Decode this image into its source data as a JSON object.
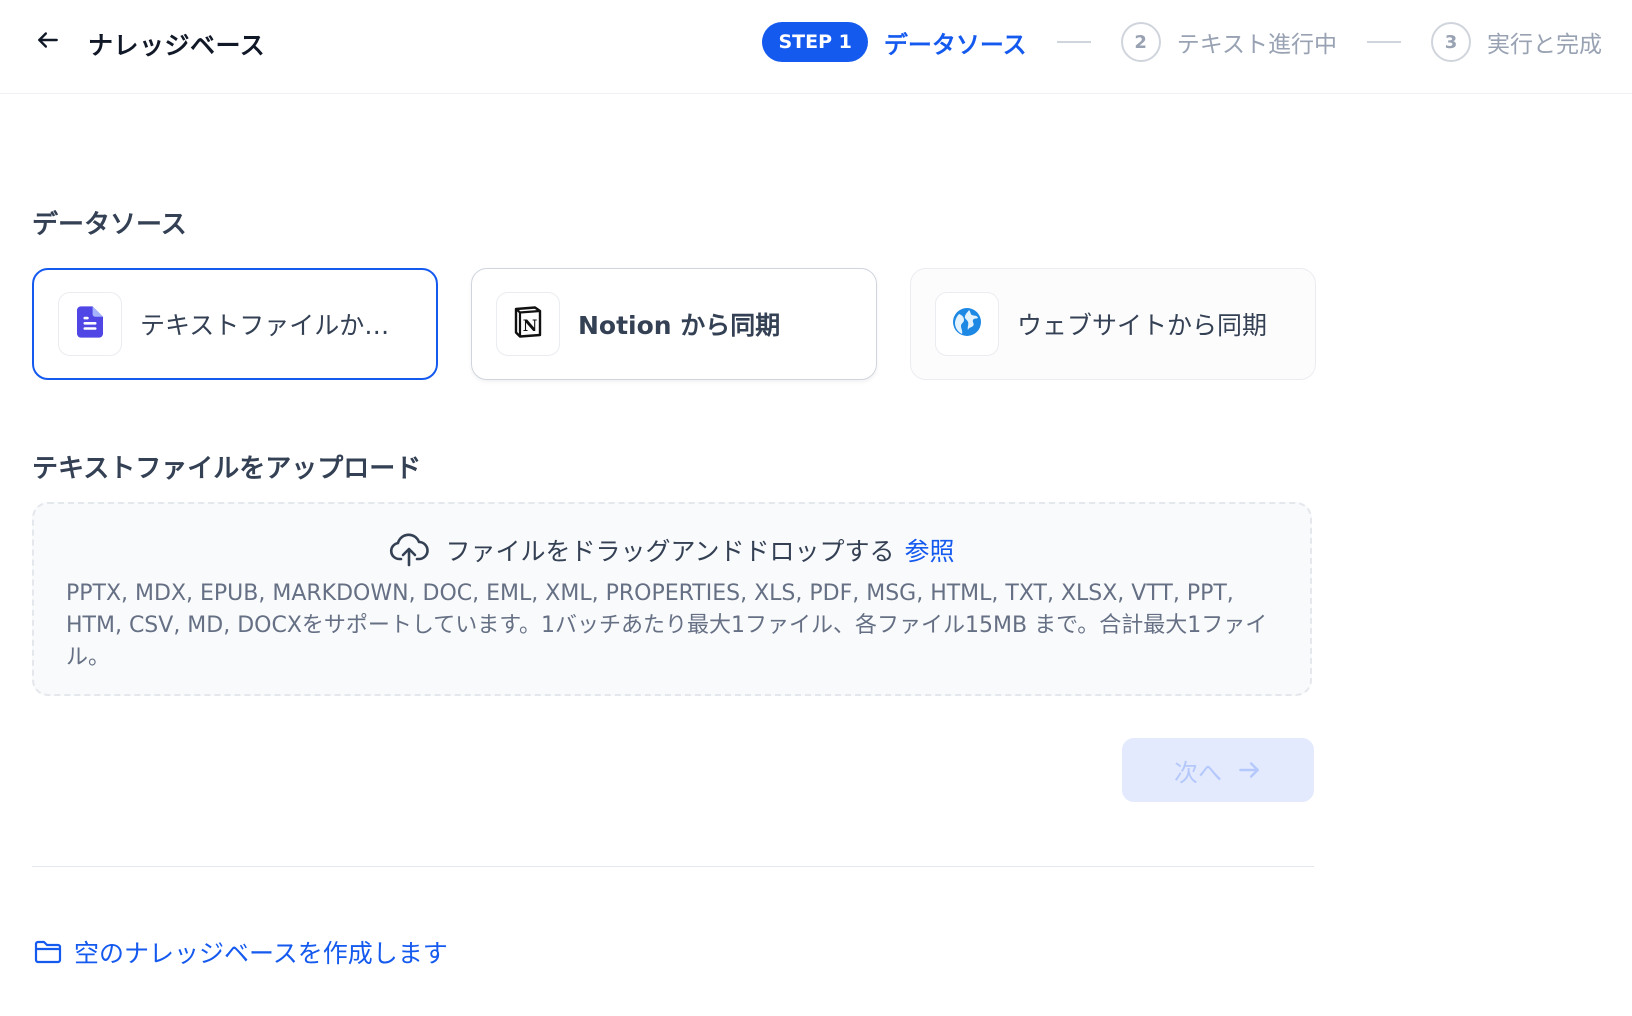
{
  "header": {
    "title": "ナレッジベース",
    "back_icon": "arrow-left-icon"
  },
  "stepper": {
    "active": {
      "badge": "STEP 1",
      "label": "データソース"
    },
    "steps": [
      {
        "number": "2",
        "label": "テキスト進行中"
      },
      {
        "number": "3",
        "label": "実行と完成"
      }
    ]
  },
  "data_source": {
    "title": "データソース",
    "options": [
      {
        "label": "テキストファイルからインポート",
        "icon": "file-text-icon",
        "selected": true
      },
      {
        "label": "Notion から同期",
        "icon": "notion-icon",
        "selected": false
      },
      {
        "label": "ウェブサイトから同期",
        "icon": "globe-icon",
        "selected": false
      }
    ]
  },
  "upload": {
    "title": "テキストファイルをアップロード",
    "drop_text": "ファイルをドラッグアンドドロップする",
    "browse_label": "参照",
    "supported_text": "PPTX, MDX, EPUB, MARKDOWN, DOC, EML, XML, PROPERTIES, XLS, PDF, MSG, HTML, TXT, XLSX, VTT, PPT, HTM, CSV, MD, DOCXをサポートしています。1バッチあたり最大1ファイル、各ファイル15MB まで。合計最大1ファイル。"
  },
  "next_button": {
    "label": "次へ",
    "disabled": true
  },
  "create_empty": {
    "label": "空のナレッジベースを作成します",
    "icon": "folder-icon"
  },
  "colors": {
    "primary": "#155aef",
    "disabled_bg": "#e3eafe",
    "disabled_text": "#b5c8fb",
    "muted": "#98a2b3"
  }
}
